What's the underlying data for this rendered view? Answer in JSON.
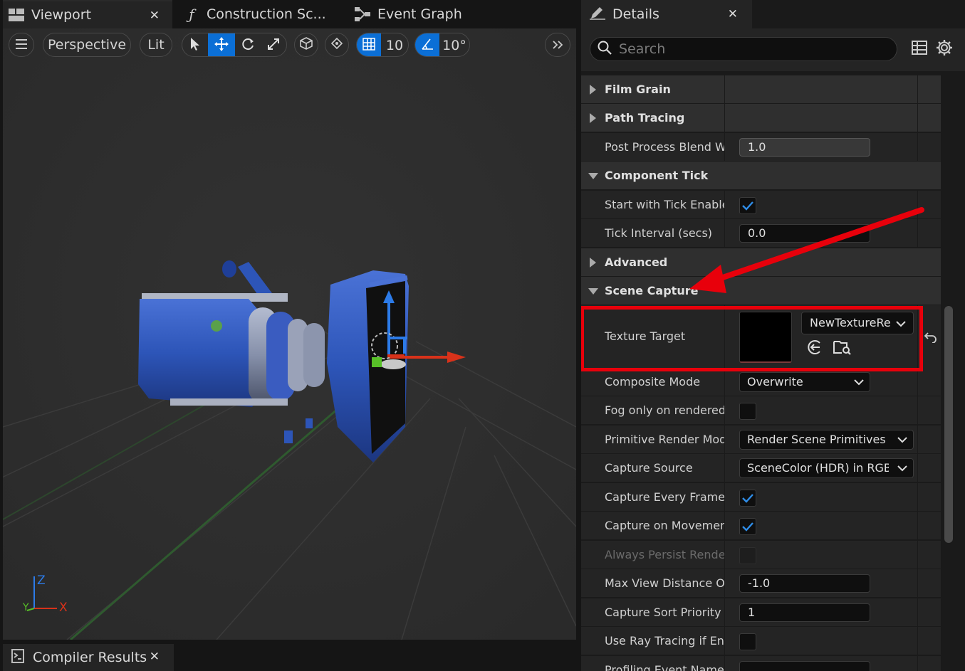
{
  "tabs": [
    {
      "label": "Viewport",
      "active": true,
      "icon": "viewport-icon"
    },
    {
      "label": "Construction Sc...",
      "active": false,
      "icon": "function-icon"
    },
    {
      "label": "Event Graph",
      "active": false,
      "icon": "graph-icon"
    }
  ],
  "viewport_toolbar": {
    "perspective": "Perspective",
    "lit": "Lit",
    "grid_snap": "10",
    "angle_snap": "10°"
  },
  "gizmo_axes": {
    "z": "Z",
    "x": "X",
    "y": "Y"
  },
  "bottom_tab": {
    "label": "Compiler Results",
    "icon": "compiler-results-icon"
  },
  "details": {
    "tab_label": "Details",
    "search_placeholder": "Search",
    "rows": [
      {
        "label": "Film Grain",
        "type": "category-collapsed"
      },
      {
        "label": "Path Tracing",
        "type": "category-collapsed"
      },
      {
        "label": "Post Process Blend W...",
        "type": "number",
        "value": "1.0"
      },
      {
        "label": "Component Tick",
        "type": "category-expanded"
      },
      {
        "label": "Start with Tick Enabled",
        "type": "checkbox",
        "checked": true
      },
      {
        "label": "Tick Interval (secs)",
        "type": "number",
        "value": "0.0"
      },
      {
        "label": "Advanced",
        "type": "category-collapsed"
      },
      {
        "label": "Scene Capture",
        "type": "category-expanded"
      }
    ],
    "texture_target": {
      "label": "Texture Target",
      "asset": "NewTextureRe"
    },
    "rows2": [
      {
        "label": "Composite Mode",
        "type": "combo",
        "value": "Overwrite"
      },
      {
        "label": "Fog only on rendered...",
        "type": "checkbox",
        "checked": false
      },
      {
        "label": "Primitive Render Mode",
        "type": "combo-wide",
        "value": "Render Scene Primitives (Le"
      },
      {
        "label": "Capture Source",
        "type": "combo-wide",
        "value": "SceneColor (HDR) in RGB, In"
      },
      {
        "label": "Capture Every Frame",
        "type": "checkbox",
        "checked": true
      },
      {
        "label": "Capture on Movement",
        "type": "checkbox",
        "checked": true
      },
      {
        "label": "Always Persist Rende...",
        "type": "checkbox-disabled",
        "checked": false
      },
      {
        "label": "Max View Distance O...",
        "type": "number",
        "value": "-1.0"
      },
      {
        "label": "Capture Sort Priority",
        "type": "number",
        "value": "1"
      },
      {
        "label": "Use Ray Tracing if En...",
        "type": "checkbox",
        "checked": false
      },
      {
        "label": "Profiling Event Name",
        "type": "text",
        "value": ""
      }
    ]
  },
  "colors": {
    "accent": "#0b6fd6",
    "highlight": "#e8000b",
    "camera_body": "#2d55b8"
  }
}
